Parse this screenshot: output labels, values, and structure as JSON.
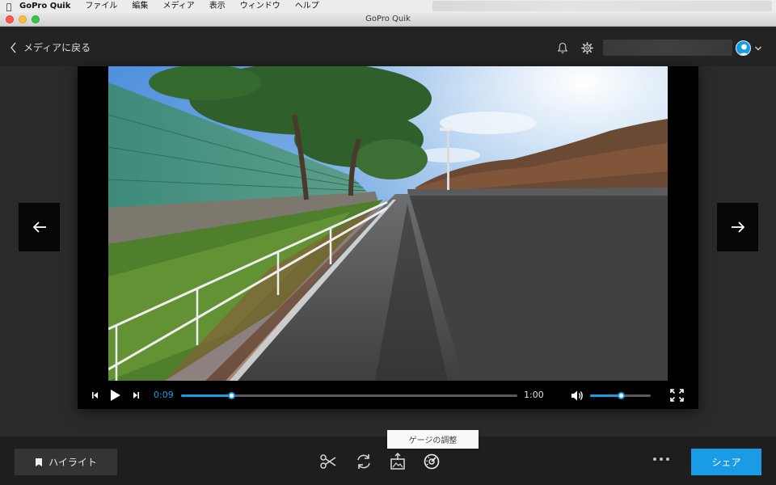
{
  "menubar": {
    "app_name": "GoPro Quik",
    "items": [
      "ファイル",
      "編集",
      "メディア",
      "表示",
      "ウィンドウ",
      "ヘルプ"
    ]
  },
  "window": {
    "title": "GoPro Quik"
  },
  "header": {
    "back_label": "メディアに戻る",
    "icons": {
      "back": "chevron-left-icon",
      "bell": "bell-icon",
      "settings": "gear-icon",
      "avatar": "user-avatar-icon",
      "menu": "chevron-down-icon"
    }
  },
  "player": {
    "current_time": "0:09",
    "total_time": "1:00",
    "progress_fraction": 0.15,
    "volume_fraction": 0.5,
    "icons": {
      "step_back": "step-back-icon",
      "play": "play-icon",
      "step_forward": "step-forward-icon",
      "volume": "volume-icon",
      "fullscreen": "fullscreen-icon"
    }
  },
  "navigation": {
    "prev_icon": "arrow-left-icon",
    "next_icon": "arrow-right-icon"
  },
  "toolbar": {
    "highlight_label": "ハイライト",
    "highlight_icon": "highlight-tag-icon",
    "tools": [
      "scissors-icon",
      "rotate-icon",
      "frame-export-icon",
      "gauge-icon"
    ],
    "tooltip": "ゲージの調整",
    "more_icon": "more-dots-icon",
    "share_label": "シェア"
  },
  "colors": {
    "accent": "#1a9be6",
    "background": "#2a2a2b",
    "header": "#232324",
    "bottom_bar": "#1e1e1f"
  }
}
